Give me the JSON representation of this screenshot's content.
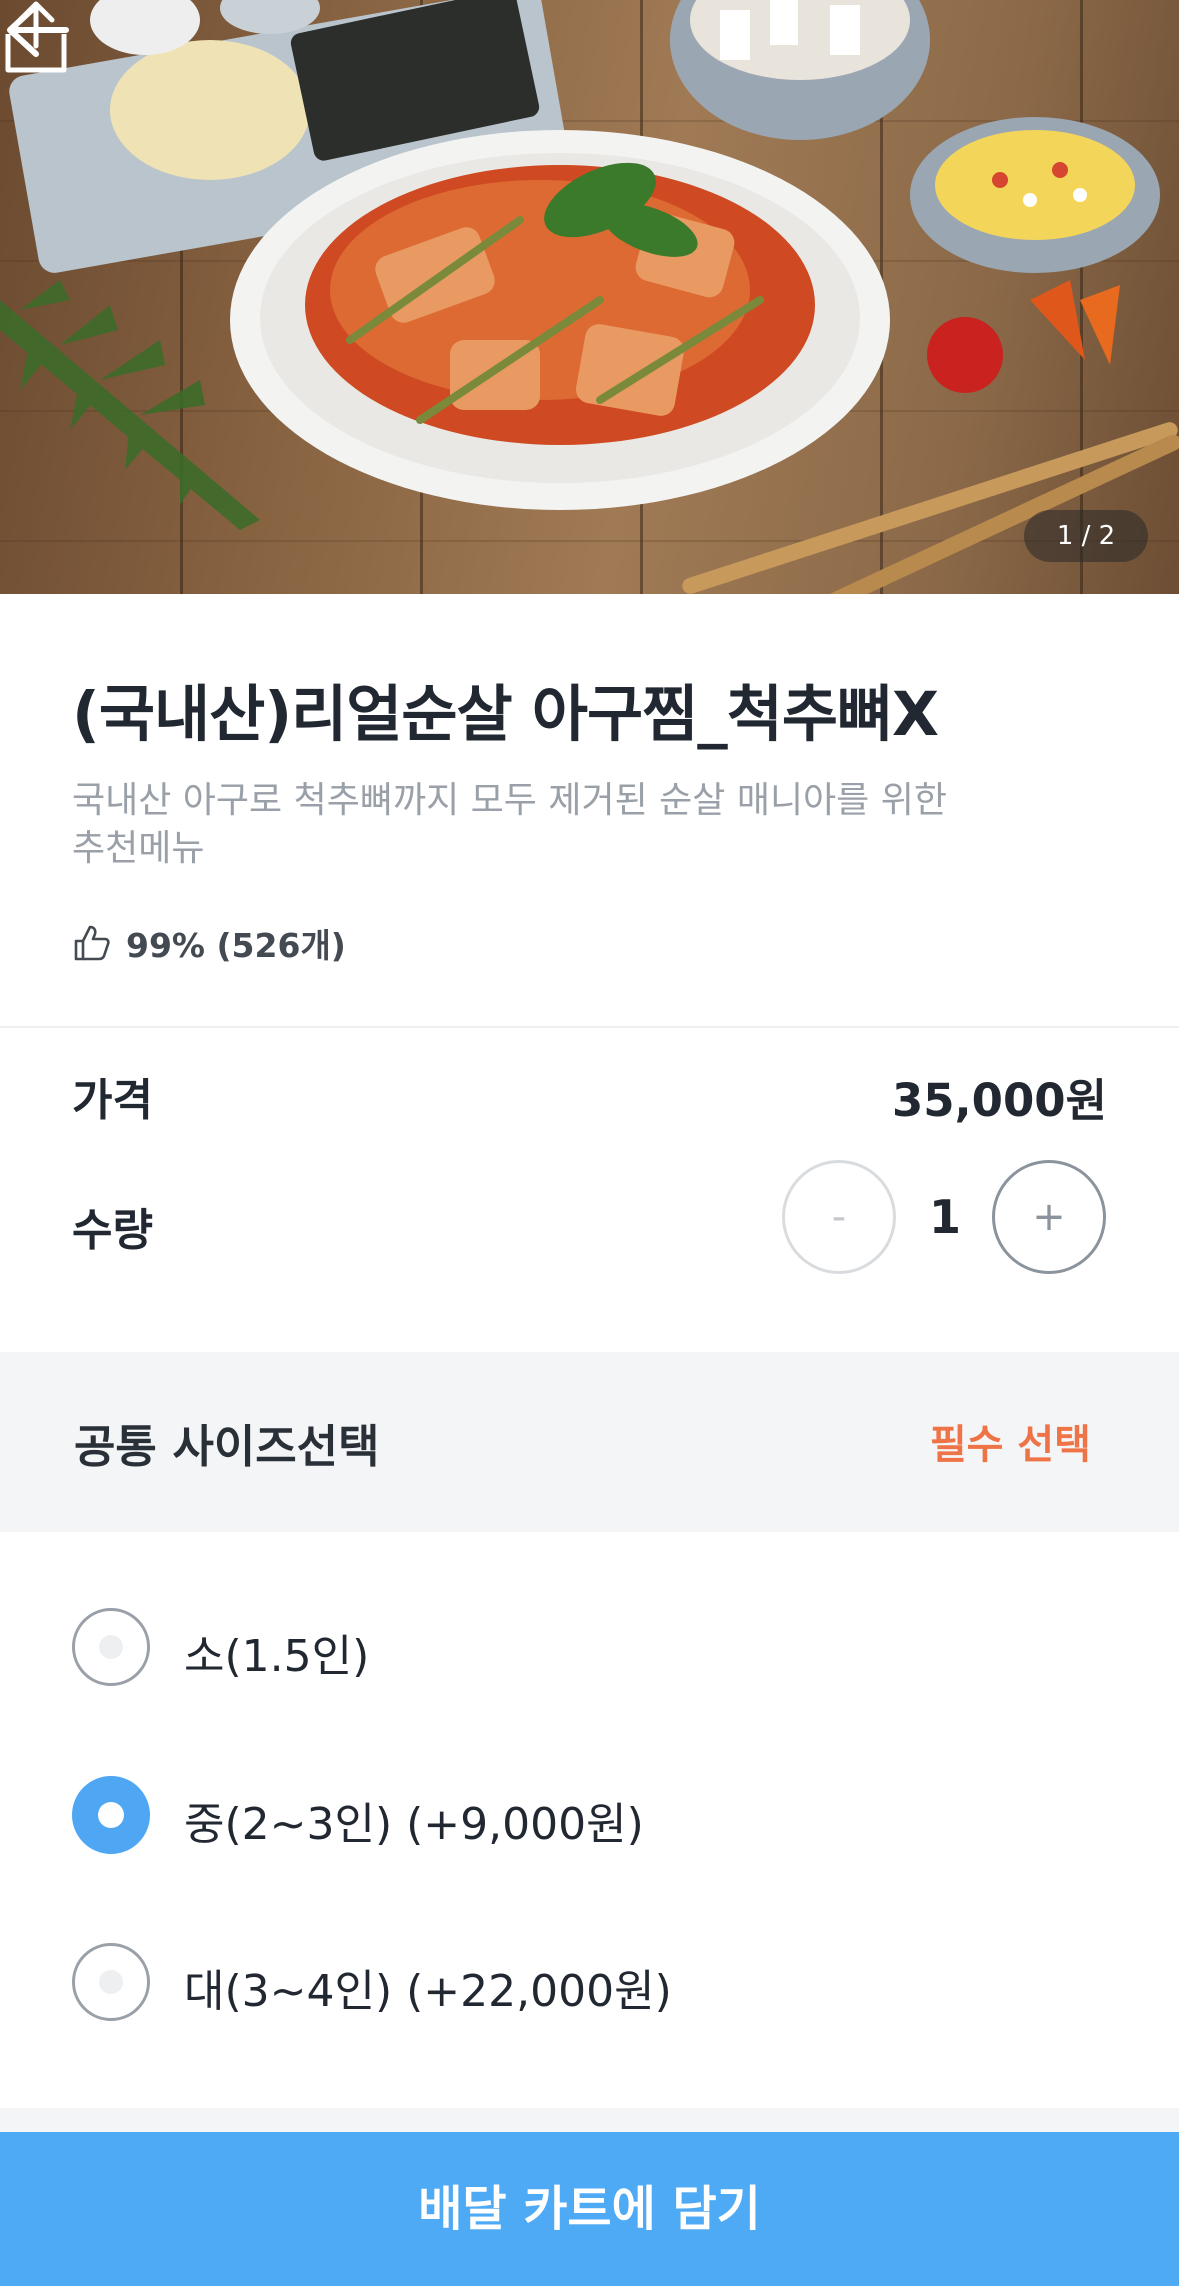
{
  "hero": {
    "pager_text": "1 / 2",
    "back_icon": "arrow-left-icon",
    "share_icon": "share-icon"
  },
  "menu": {
    "title": "(국내산)리얼순살 아구찜_척추뼈X",
    "description": "국내산 아구로 척추뼈까지 모두 제거된 순살 매니아를 위한 추천메뉴",
    "rating_text": "99% (526개)",
    "rating_icon": "thumbs-up-icon"
  },
  "price": {
    "label": "가격",
    "value": "35,000원"
  },
  "quantity": {
    "label": "수량",
    "minus": "-",
    "value": "1",
    "plus": "+"
  },
  "options": {
    "title": "공통 사이즈선택",
    "required_label": "필수 선택",
    "items": [
      {
        "label": "소(1.5인)",
        "selected": false
      },
      {
        "label": "중(2~3인) (+9,000원)",
        "selected": true
      },
      {
        "label": "대(3~4인) (+22,000원)",
        "selected": false
      }
    ]
  },
  "cart_button": {
    "label": "배달 카트에 담기"
  },
  "colors": {
    "accent_blue": "#4faaf5",
    "required_orange": "#ee7447",
    "text_dark": "#222831",
    "text_muted": "#9aa0a8"
  }
}
